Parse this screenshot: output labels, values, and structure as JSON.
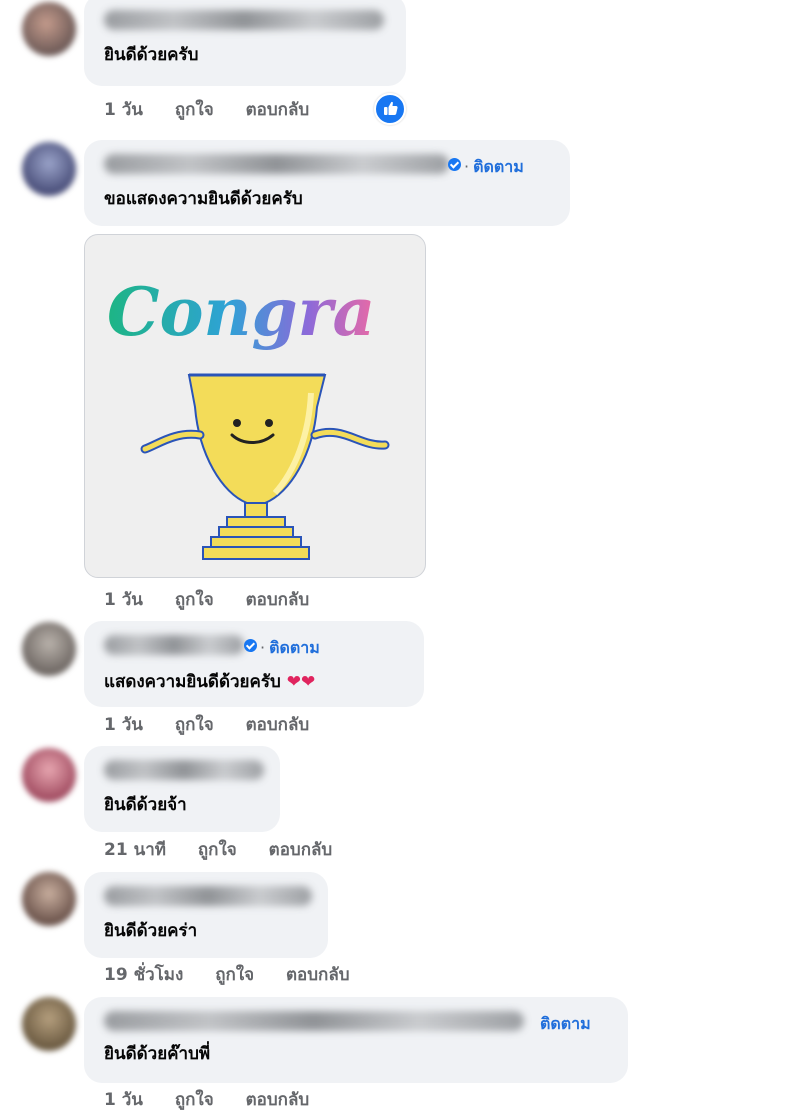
{
  "comments": [
    {
      "text": "ยินดีด้วยครับ",
      "time": "1 วัน",
      "like": "ถูกใจ",
      "reply": "ตอบกลับ",
      "reaction_icon": "thumbs-up-icon"
    },
    {
      "text": "ขอแสดงความยินดีด้วยครับ",
      "follow": "ติดตาม",
      "time": "1 วัน",
      "like": "ถูกใจ",
      "reply": "ตอบกลับ",
      "sticker_text": "Congra"
    },
    {
      "text": "แสดงความยินดีด้วยครับ",
      "emoji": "❤❤",
      "follow": "ติดตาม",
      "time": "1 วัน",
      "like": "ถูกใจ",
      "reply": "ตอบกลับ"
    },
    {
      "text": "ยินดีด้วยจ้า",
      "time": "21 นาที",
      "like": "ถูกใจ",
      "reply": "ตอบกลับ"
    },
    {
      "text": "ยินดีด้วยคร่า",
      "time": "19 ชั่วโมง",
      "like": "ถูกใจ",
      "reply": "ตอบกลับ"
    },
    {
      "text": "ยินดีด้วยค๊าบพี่",
      "follow": "ติดตาม",
      "time": "1 วัน",
      "like": "ถูกใจ",
      "reply": "ตอบกลับ"
    }
  ],
  "colors": {
    "bubble": "#f0f2f5",
    "meta_text": "#65676b",
    "link_blue": "#216fdb",
    "like_blue": "#1877f2"
  }
}
